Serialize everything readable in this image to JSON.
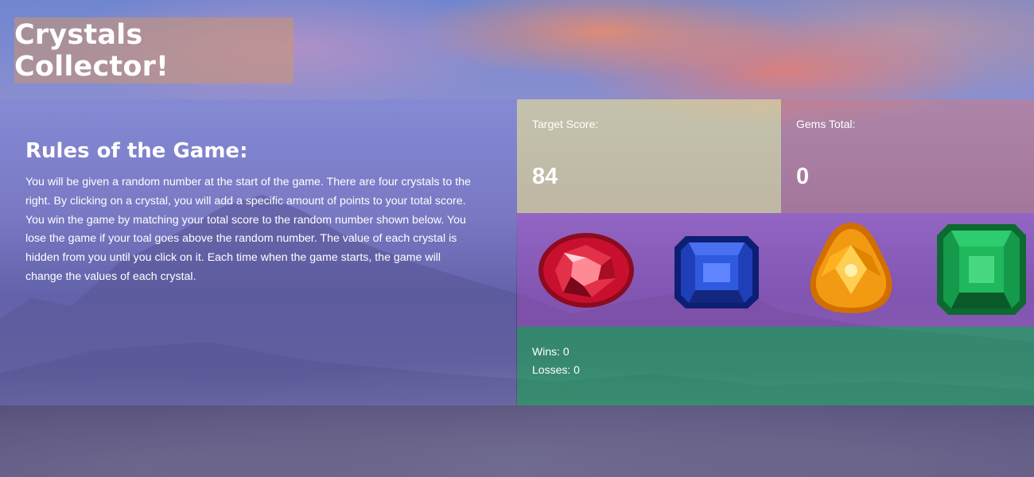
{
  "header": {
    "title": "Crystals Collector!"
  },
  "rules": {
    "heading": "Rules of the Game:",
    "text": "You will be given a random number at the start of the game. There are four crystals to the right. By clicking on a crystal, you will add a specific amount of points to your total score. You win the game by matching your total score to the random number shown below. You lose the game if your toal goes above the random number. The value of each crystal is hidden from you until you click on it. Each time when the game starts, the game will change the values of each crystal."
  },
  "target": {
    "label": "Target Score:",
    "value": "84"
  },
  "gems": {
    "label": "Gems Total:",
    "value": "0"
  },
  "crystals": [
    {
      "name": "ruby",
      "color": "#c8102e"
    },
    {
      "name": "sapphire",
      "color": "#1f3fb8"
    },
    {
      "name": "citrine",
      "color": "#f29a12"
    },
    {
      "name": "emerald",
      "color": "#15994a"
    }
  ],
  "results": {
    "wins": "Wins: 0",
    "losses": "Losses: 0"
  }
}
